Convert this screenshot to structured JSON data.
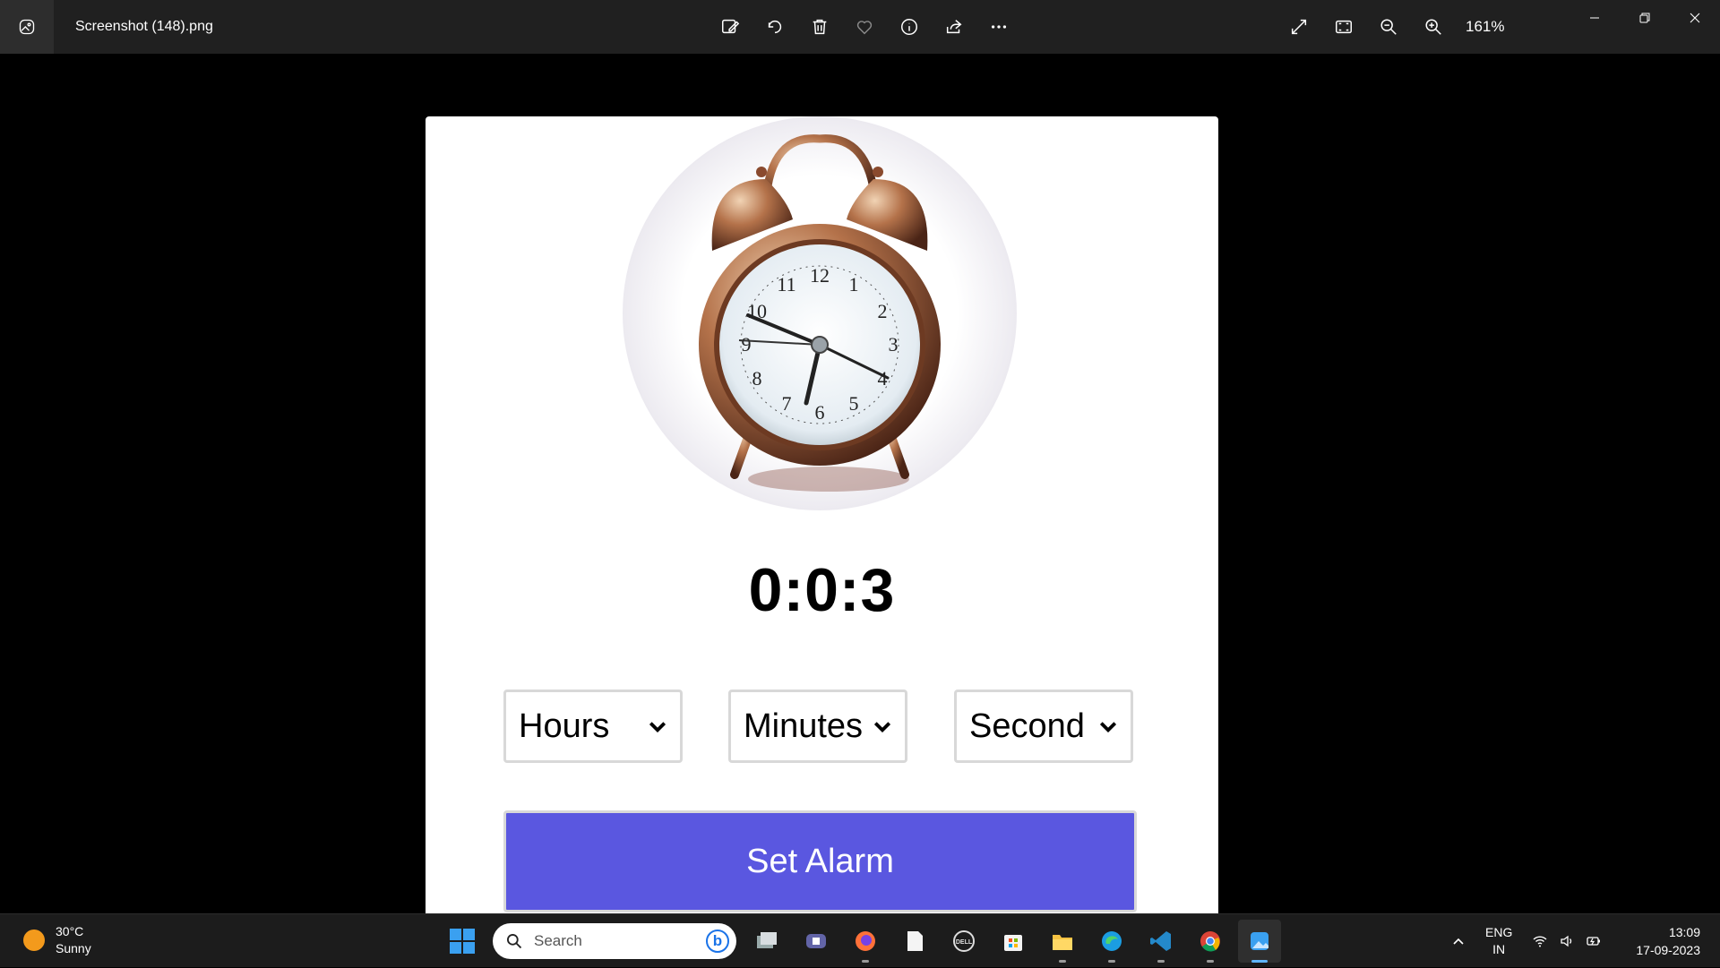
{
  "titlebar": {
    "file_name": "Screenshot (148).png",
    "zoom": "161%",
    "toolbar_icons": [
      "edit-icon",
      "rotate-icon",
      "delete-icon",
      "favorite-icon",
      "info-icon",
      "share-icon",
      "more-icon"
    ],
    "view_icons": [
      "fullscreen-icon",
      "fit-icon",
      "zoom-out-icon",
      "zoom-in-icon"
    ]
  },
  "alarm_app": {
    "time": "0:0:3",
    "hours_label": "Hours",
    "minutes_label": "Minutes",
    "seconds_label": "Second",
    "set_button": "Set Alarm",
    "accent_color": "#5a57e0"
  },
  "taskbar": {
    "weather_temp": "30°C",
    "weather_desc": "Sunny",
    "search_placeholder": "Search",
    "bing_letter": "b",
    "lang_top": "ENG",
    "lang_bottom": "IN",
    "time": "13:09",
    "date": "17-09-2023",
    "apps": [
      "start-icon",
      "task-view-icon",
      "teams-icon",
      "firefox-icon",
      "notepad-icon",
      "dell-icon",
      "store-icon",
      "file-explorer-icon",
      "edge-icon",
      "vscode-icon",
      "chrome-icon",
      "photos-icon"
    ]
  }
}
